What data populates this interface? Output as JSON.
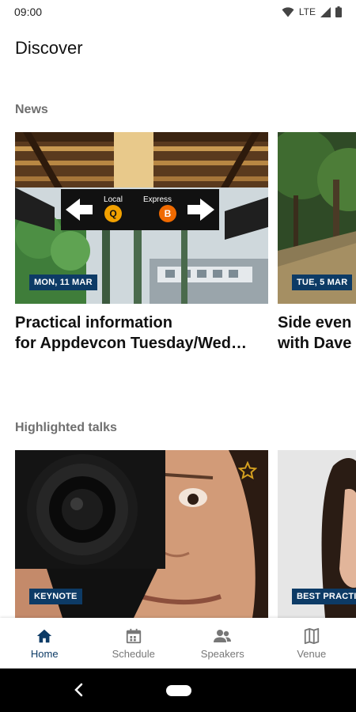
{
  "status_bar": {
    "time": "09:00",
    "network": "LTE",
    "icons": [
      "wifi-icon",
      "signal-icon",
      "battery-icon"
    ]
  },
  "page": {
    "title": "Discover"
  },
  "news": {
    "section_title": "News",
    "cards": [
      {
        "date": "MON, 11 MAR",
        "title_line1": "Practical information",
        "title_line2": "for Appdevcon Tuesday/Wed…",
        "image": "subway-station-photo"
      },
      {
        "date": "TUE, 5 MAR",
        "title_line1": "Side even",
        "title_line2": "with Dave",
        "image": "forest-path-photo"
      }
    ]
  },
  "talks": {
    "section_title": "Highlighted talks",
    "cards": [
      {
        "tag": "KEYNOTE",
        "image": "photographer-with-camera-photo",
        "favorite_icon": "star-outline-icon"
      },
      {
        "tag": "BEST PRACTIC",
        "image": "speaker-portrait-photo"
      }
    ]
  },
  "bottom_nav": {
    "items": [
      {
        "label": "Home",
        "icon": "home-icon",
        "active": true
      },
      {
        "label": "Schedule",
        "icon": "calendar-icon",
        "active": false
      },
      {
        "label": "Speakers",
        "icon": "people-icon",
        "active": false
      },
      {
        "label": "Venue",
        "icon": "map-icon",
        "active": false
      }
    ]
  },
  "sign_text": {
    "local": "Local",
    "express": "Express",
    "local_letter": "Q",
    "express_letter": "B"
  },
  "colors": {
    "accent": "#0d3b66",
    "inactive": "#777777",
    "section_title": "#6f6f6f"
  }
}
